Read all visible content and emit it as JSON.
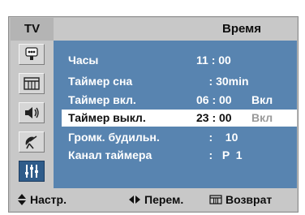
{
  "tab": {
    "label": "TV"
  },
  "title": "Время",
  "sidebar": {
    "icons": [
      "input-icon",
      "picture-icon",
      "sound-icon",
      "channel-icon",
      "setup-icon"
    ],
    "active": "setup-icon"
  },
  "menu": {
    "rows": [
      {
        "label": "Часы",
        "value": "11 : 00",
        "suffix": ""
      },
      {
        "label": "Таймер сна",
        "value": "    : 30min",
        "suffix": ""
      },
      {
        "label": "Таймер вкл.",
        "value": "06 : 00",
        "suffix": "Вкл"
      },
      {
        "label": "Таймер выкл.",
        "value": "23 : 00",
        "suffix": "Вкл"
      },
      {
        "label": "Громк. будильн.",
        "value": "    :    10",
        "suffix": ""
      },
      {
        "label": "Канал таймера",
        "value": "    :   P  1",
        "suffix": ""
      }
    ],
    "selected_index": 3
  },
  "footer": {
    "adjust": "Настр.",
    "move": "Перем.",
    "return": "Возврат"
  },
  "colors": {
    "panel": "#5884b0",
    "frame": "#bdbdbd",
    "highlight": "#ffffff",
    "active_icon": "#2f5c8a"
  }
}
